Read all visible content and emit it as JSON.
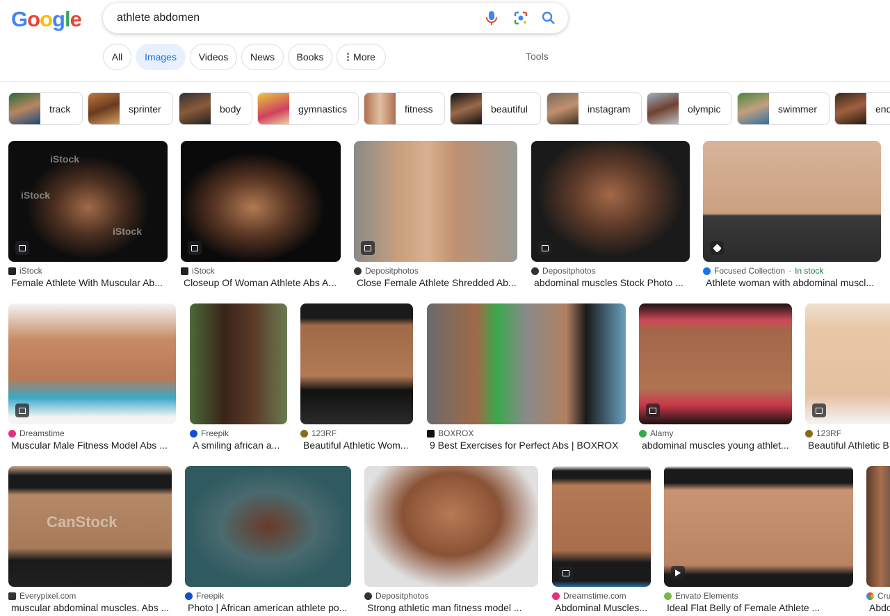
{
  "search": {
    "query": "athlete abdomen"
  },
  "logo": {
    "letters": [
      "G",
      "o",
      "o",
      "g",
      "l",
      "e"
    ],
    "colors": [
      "#4285f4",
      "#ea4335",
      "#fbbc05",
      "#4285f4",
      "#34a853",
      "#ea4335"
    ]
  },
  "tabs": [
    {
      "label": "All"
    },
    {
      "label": "Images",
      "active": true
    },
    {
      "label": "Videos"
    },
    {
      "label": "News"
    },
    {
      "label": "Books"
    },
    {
      "label": "More"
    }
  ],
  "tools_label": "Tools",
  "chips": [
    "track",
    "sprinter",
    "body",
    "gymnastics",
    "fitness",
    "beautiful",
    "instagram",
    "olympic",
    "swimmer",
    "end"
  ],
  "results": [
    {
      "source": "iStock",
      "title": "Female Athlete With Muscular Ab...",
      "watermark": "iStock"
    },
    {
      "source": "iStock",
      "title": "Closeup Of Woman Athlete Abs A..."
    },
    {
      "source": "Depositphotos",
      "title": "Close Female Athlete Shredded Ab..."
    },
    {
      "source": "Depositphotos",
      "title": "abdominal muscles Stock Photo ..."
    },
    {
      "source": "Focused Collection",
      "stock": "In stock",
      "title": "Athlete woman with abdominal muscl..."
    },
    {
      "source": "Dreamstime",
      "title": "Muscular Male Fitness Model Abs ..."
    },
    {
      "source": "Freepik",
      "title": "A smiling african a..."
    },
    {
      "source": "123RF",
      "title": "Beautiful Athletic Wom..."
    },
    {
      "source": "BOXROX",
      "title": "9 Best Exercises for Perfect Abs | BOXROX"
    },
    {
      "source": "Alamy",
      "title": "abdominal muscles young athlet..."
    },
    {
      "source": "123RF",
      "title": "Beautiful Athletic B..."
    },
    {
      "source": "Everypixel.com",
      "title": "muscular abdominal muscles. Abs ...",
      "watermark": "CanStock"
    },
    {
      "source": "Freepik",
      "title": "Photo | African american athlete po..."
    },
    {
      "source": "Depositphotos",
      "title": "Strong athletic man fitness model ..."
    },
    {
      "source": "Dreamstime.com",
      "title": "Abdominal Muscles..."
    },
    {
      "source": "Envato Elements",
      "title": "Ideal Flat Belly of Female Athlete ..."
    },
    {
      "source": "Cru",
      "title": "Abdo..."
    }
  ]
}
